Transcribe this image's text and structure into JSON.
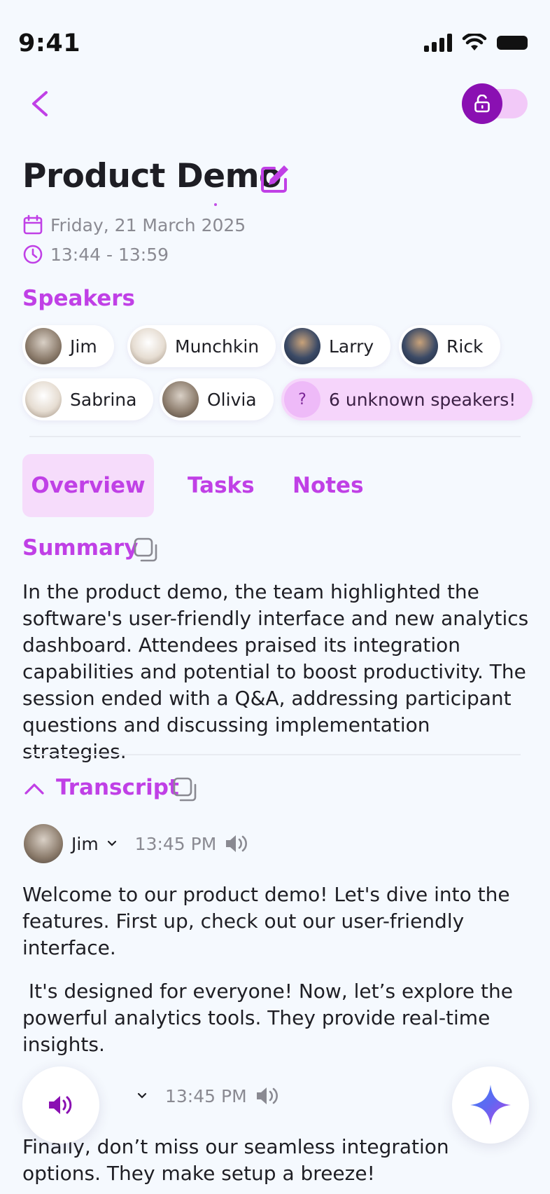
{
  "status": {
    "time": "9:41"
  },
  "meeting": {
    "title": "Product Demo",
    "date": "Friday, 21 March 2025",
    "time_range": "13:44 - 13:59"
  },
  "speakers": {
    "label": "Speakers",
    "list": [
      "Jim",
      "Munchkin",
      "Larry",
      "Rick",
      "Sabrina",
      "Olivia"
    ],
    "unknown_badge": "?",
    "unknown_label": "6 unknown speakers!"
  },
  "tabs": [
    {
      "label": "Overview",
      "active": true
    },
    {
      "label": "Tasks",
      "active": false
    },
    {
      "label": "Notes",
      "active": false
    }
  ],
  "summary": {
    "title": "Summary",
    "text": "In the product demo, the team highlighted the software's user-friendly interface and new analytics dashboard. Attendees praised its integration capabilities and potential to boost productivity. The session ended with a Q&A, addressing participant questions and discussing implementation strategies."
  },
  "transcript": {
    "title": "Transcript",
    "entries": [
      {
        "speaker": "Jim",
        "time": "13:45 PM",
        "paragraphs": [
          "Welcome to our product demo! Let's dive into the features. First up, check out our user-friendly interface.",
          " It's designed for everyone! Now, let’s explore the powerful analytics tools. They provide real-time insights."
        ]
      },
      {
        "speaker": "",
        "time": "13:45 PM",
        "paragraphs": [
          "Finally, don’t miss our seamless integration options. They make setup a breeze!"
        ]
      }
    ]
  },
  "colors": {
    "accent": "#c040e6",
    "accent_dark": "#8a10b2",
    "background": "#f5f9fe"
  }
}
